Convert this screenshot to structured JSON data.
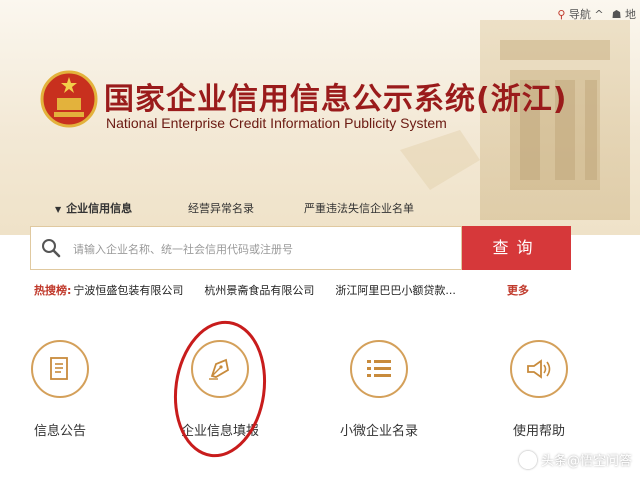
{
  "header": {
    "nav": [
      {
        "label": "导航",
        "icon": "location-pin-icon"
      },
      {
        "label": "地"
      }
    ],
    "title_cn": "国家企业信用信息公示系统(浙江)",
    "title_en": "National Enterprise Credit Information Publicity System"
  },
  "tabs": [
    {
      "label": "企业信用信息",
      "active": true
    },
    {
      "label": "经营异常名录",
      "active": false
    },
    {
      "label": "严重违法失信企业名单",
      "active": false
    }
  ],
  "search": {
    "placeholder": "请输入企业名称、统一社会信用代码或注册号",
    "button_label": "查询"
  },
  "hot_search": {
    "label": "热搜榜:",
    "items": [
      "宁波恒盛包装有限公司",
      "杭州景斋食品有限公司",
      "浙江阿里巴巴小额贷款..."
    ],
    "more": "更多"
  },
  "services": [
    {
      "label": "信息公告",
      "icon": "document-icon"
    },
    {
      "label": "企业信息填报",
      "icon": "pen-icon"
    },
    {
      "label": "小微企业名录",
      "icon": "list-icon"
    },
    {
      "label": "使用帮助",
      "icon": "speaker-icon"
    }
  ],
  "watermark": "头条@悟空问答",
  "colors": {
    "brand_red": "#d6383a",
    "title_red": "#9a1b1b",
    "gold": "#d4a05a"
  }
}
